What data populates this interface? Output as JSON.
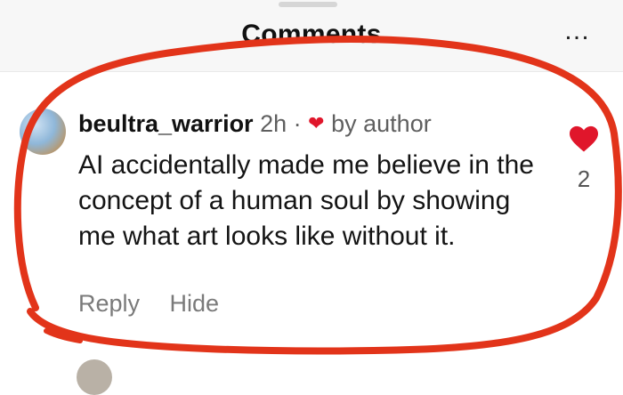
{
  "header": {
    "title": "Comments",
    "more_icon": "more-dots-icon"
  },
  "comment": {
    "username": "beultra_warrior",
    "time": "2h",
    "separator": "·",
    "badge": "by author",
    "text": "AI accidentally made me believe in the concept of a human soul by showing me what art looks like without it.",
    "actions": {
      "reply": "Reply",
      "hide": "Hide"
    },
    "like_count": "2"
  },
  "colors": {
    "heart": "#e0162b",
    "annotation": "#e2341a"
  }
}
